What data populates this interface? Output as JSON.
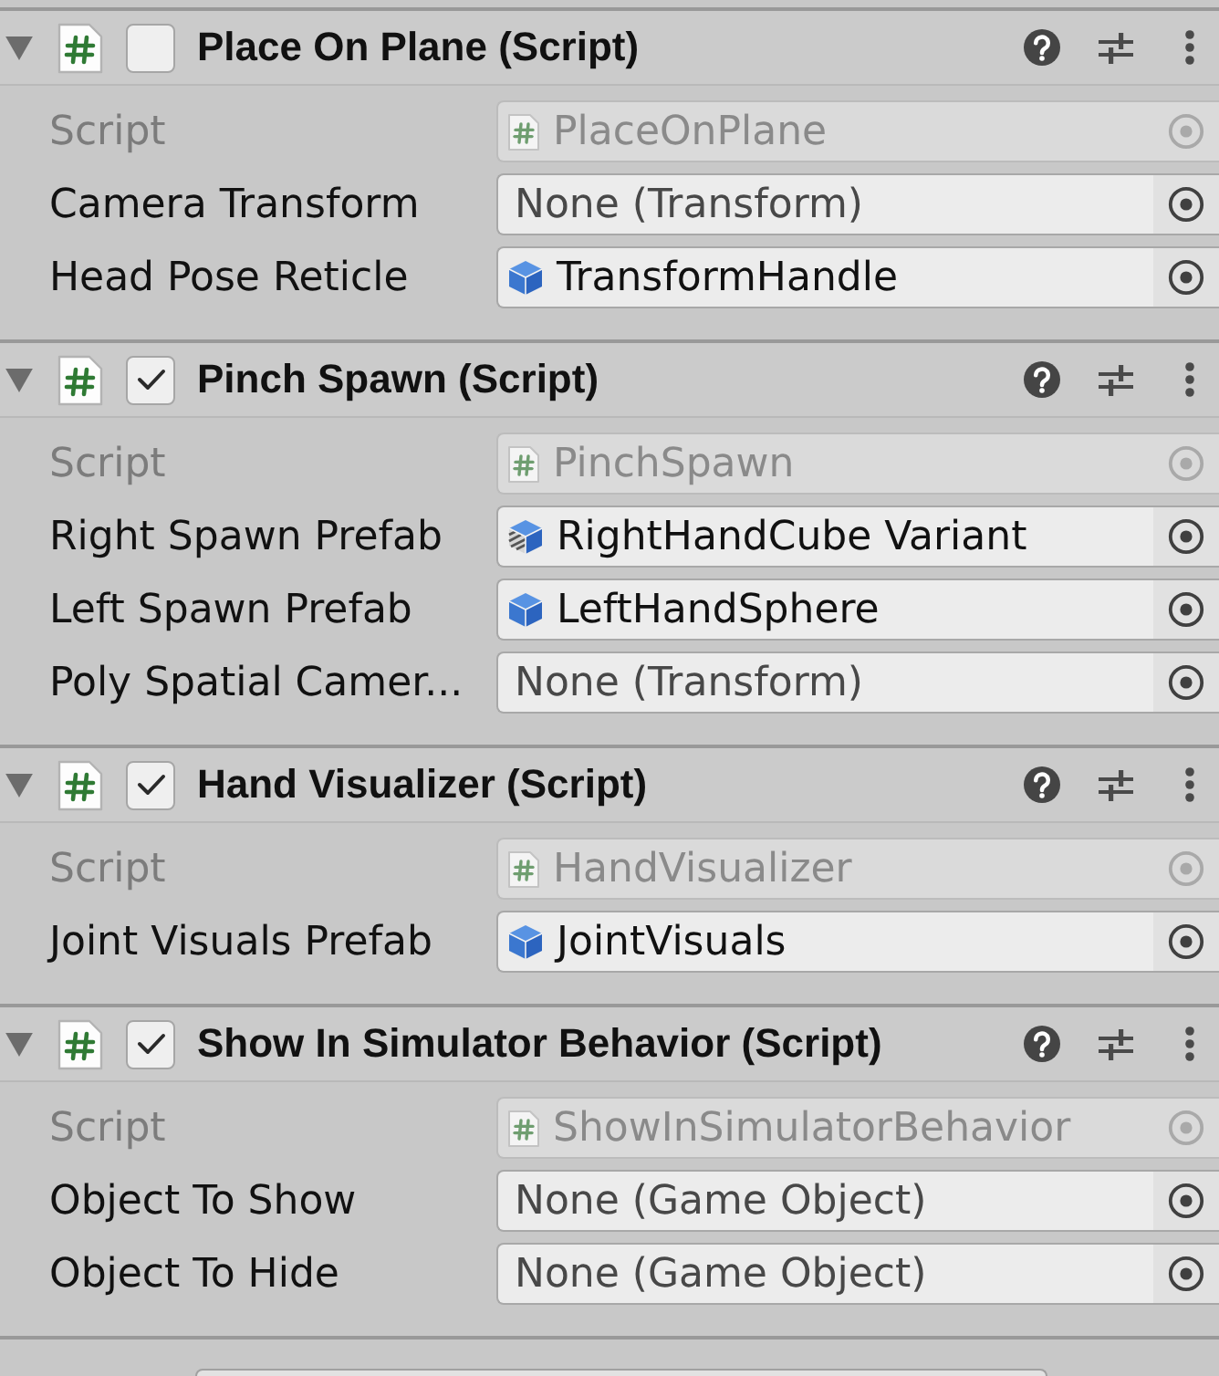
{
  "components": [
    {
      "title": "Place On Plane (Script)",
      "expanded": true,
      "enabled": false,
      "fields": [
        {
          "label": "Script",
          "kind": "script",
          "value": "PlaceOnPlane",
          "disabled": true
        },
        {
          "label": "Camera Transform",
          "kind": "none",
          "value": "None (Transform)",
          "disabled": false
        },
        {
          "label": "Head Pose Reticle",
          "kind": "prefab",
          "value": "TransformHandle",
          "disabled": false
        }
      ]
    },
    {
      "title": "Pinch Spawn (Script)",
      "expanded": true,
      "enabled": true,
      "fields": [
        {
          "label": "Script",
          "kind": "script",
          "value": "PinchSpawn",
          "disabled": true
        },
        {
          "label": "Right Spawn Prefab",
          "kind": "prefab_variant",
          "value": "RightHandCube Variant",
          "disabled": false
        },
        {
          "label": "Left Spawn Prefab",
          "kind": "prefab",
          "value": "LeftHandSphere",
          "disabled": false
        },
        {
          "label": "Poly Spatial Camer...",
          "kind": "none",
          "value": "None (Transform)",
          "disabled": false
        }
      ]
    },
    {
      "title": "Hand Visualizer (Script)",
      "expanded": true,
      "enabled": true,
      "fields": [
        {
          "label": "Script",
          "kind": "script",
          "value": "HandVisualizer",
          "disabled": true
        },
        {
          "label": "Joint Visuals Prefab",
          "kind": "prefab",
          "value": "JointVisuals",
          "disabled": false
        }
      ]
    },
    {
      "title": "Show In Simulator Behavior (Script)",
      "expanded": true,
      "enabled": true,
      "fields": [
        {
          "label": "Script",
          "kind": "script",
          "value": "ShowInSimulatorBehavior",
          "disabled": true
        },
        {
          "label": "Object To Show",
          "kind": "none",
          "value": "None (Game Object)",
          "disabled": false
        },
        {
          "label": "Object To Hide",
          "kind": "none",
          "value": "None (Game Object)",
          "disabled": false
        }
      ]
    }
  ]
}
